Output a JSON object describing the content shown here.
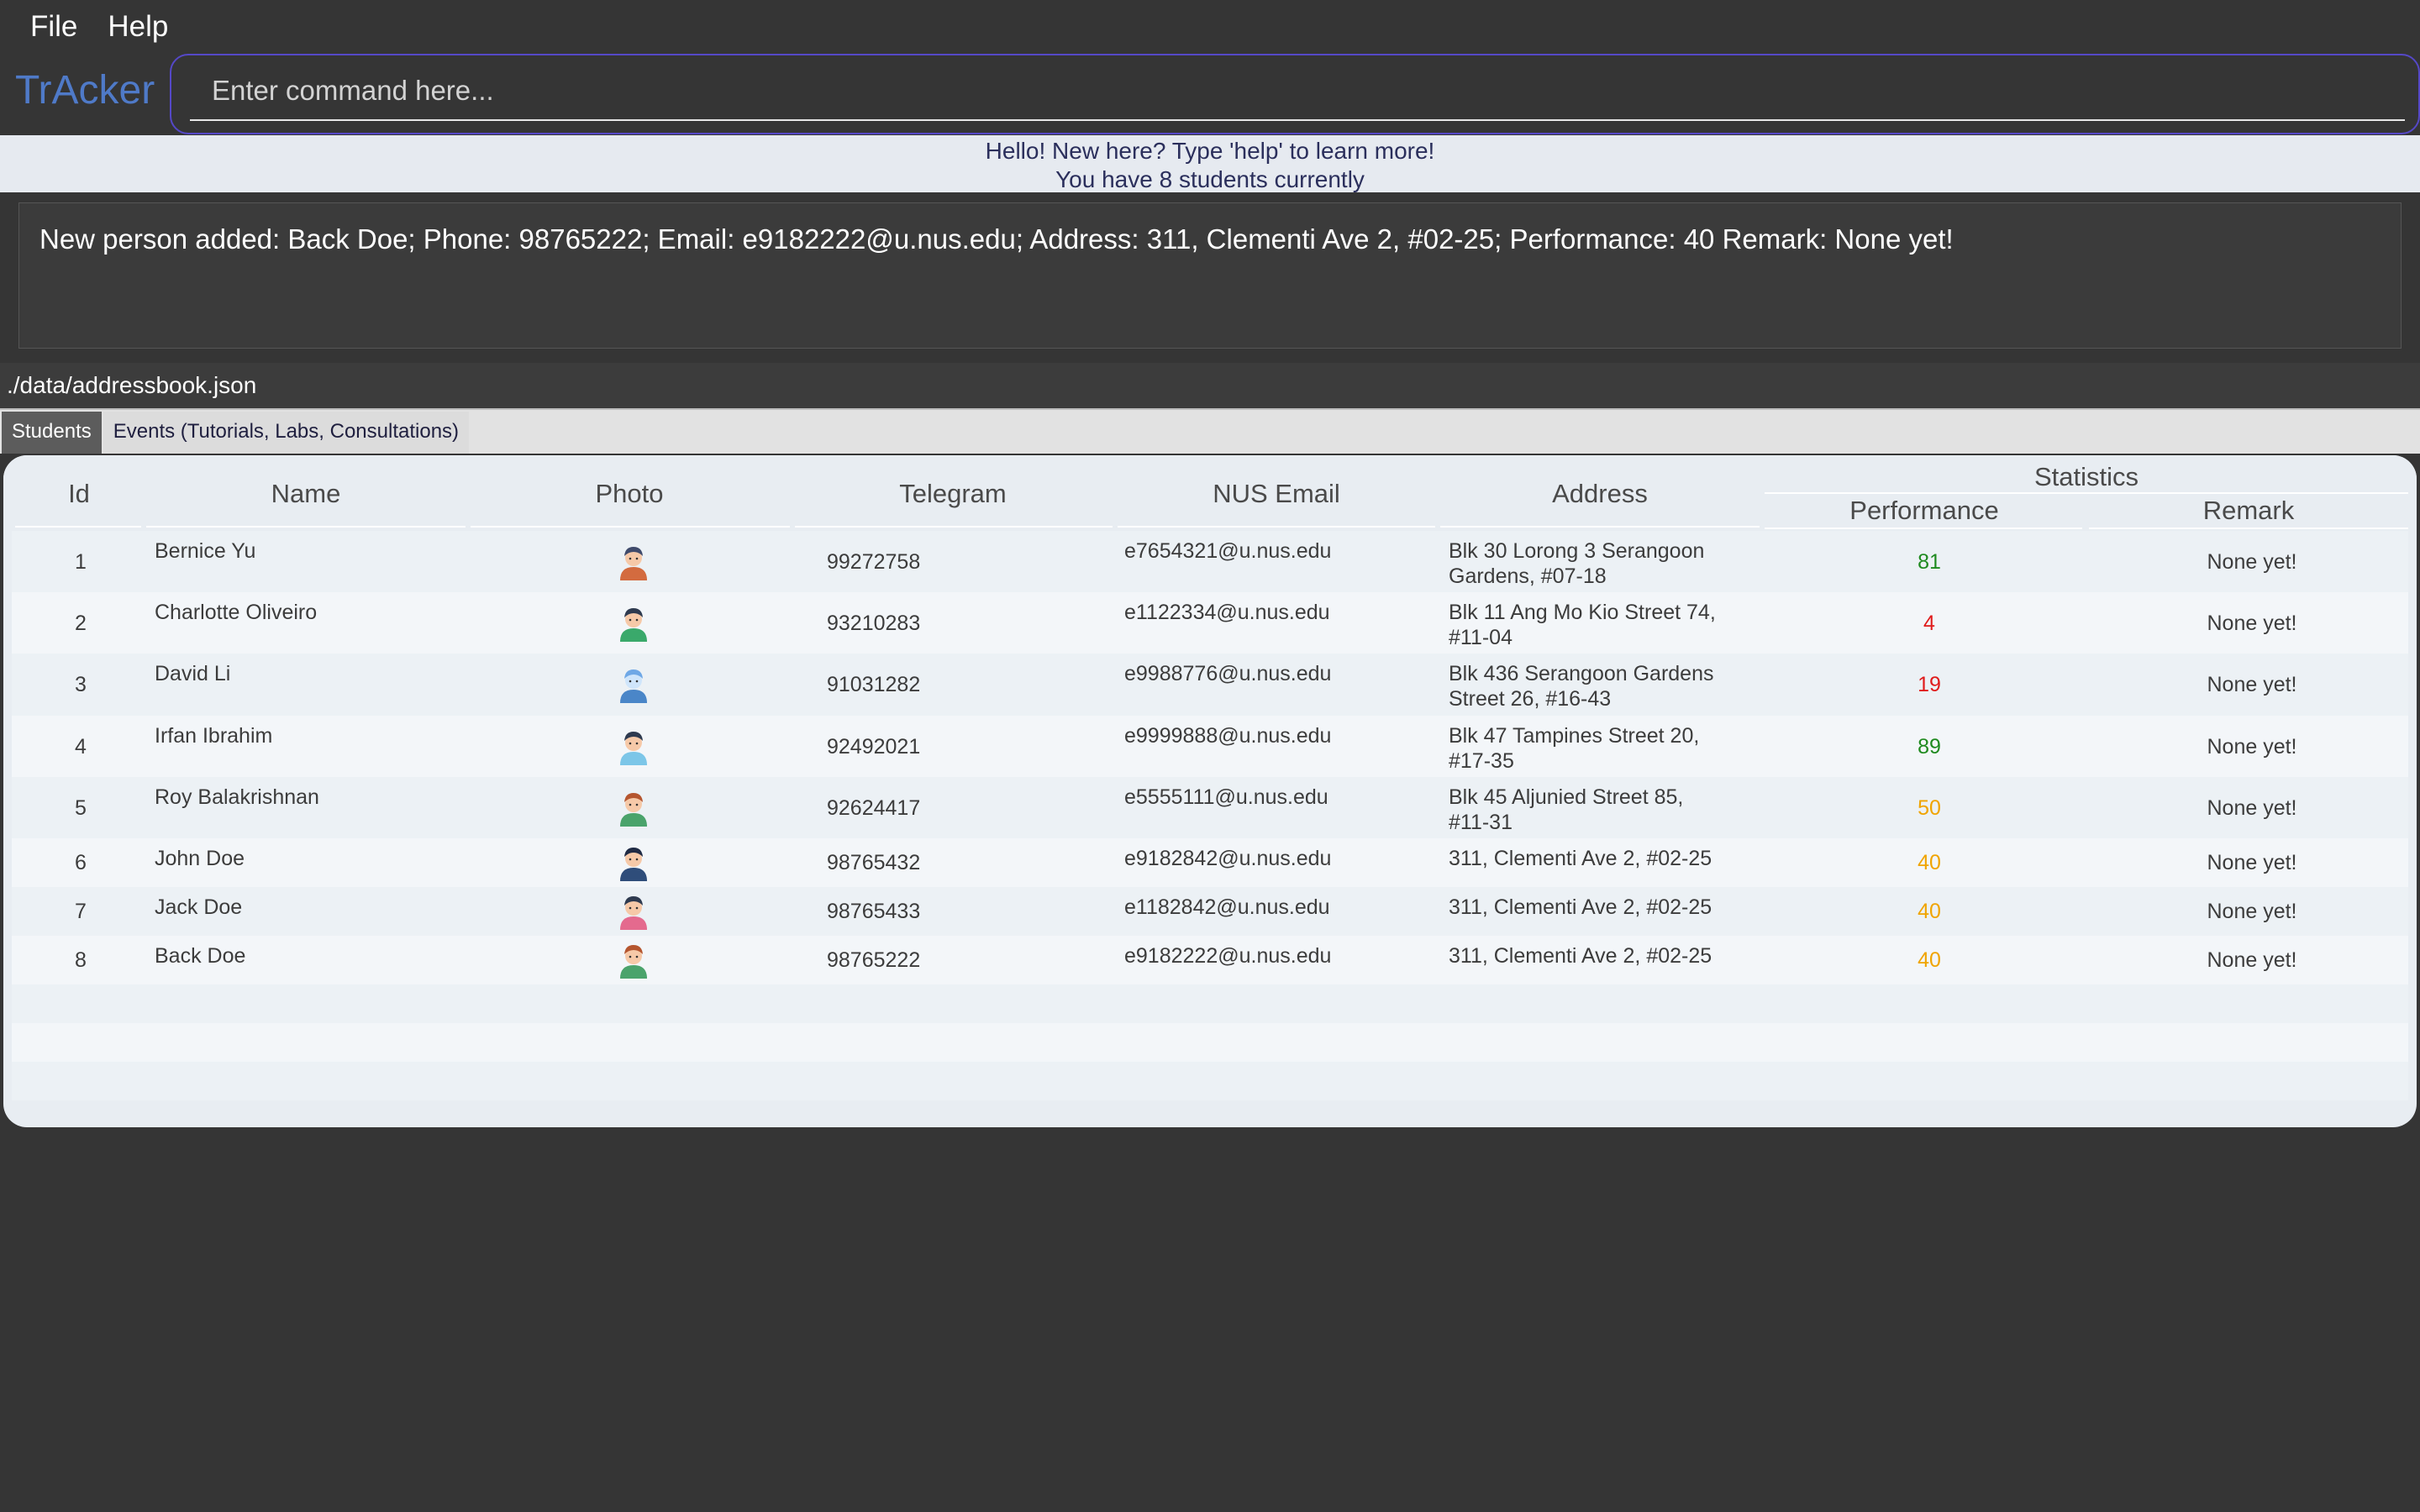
{
  "menu": {
    "file": "File",
    "help": "Help"
  },
  "app": {
    "title": "TrAcker"
  },
  "command": {
    "placeholder": "Enter command here...",
    "value": ""
  },
  "banner": {
    "line1": "Hello! New here? Type 'help' to learn more!",
    "line2": "You have 8 students currently"
  },
  "result": {
    "text": "New person added: Back Doe; Phone: 98765222; Email: e9182222@u.nus.edu; Address: 311, Clementi Ave 2, #02-25; Performance: 40 Remark: None yet!"
  },
  "path": "./data/addressbook.json",
  "tabs": [
    {
      "label": "Students",
      "active": true
    },
    {
      "label": "Events (Tutorials, Labs, Consultations)",
      "active": false
    }
  ],
  "table": {
    "headers": {
      "id": "Id",
      "name": "Name",
      "photo": "Photo",
      "telegram": "Telegram",
      "email": "NUS Email",
      "address": "Address",
      "statistics": "Statistics",
      "performance": "Performance",
      "remark": "Remark"
    },
    "colors": {
      "high": "#1f8a1f",
      "low": "#e01b1b",
      "mid": "#f0a400"
    },
    "rows": [
      {
        "id": "1",
        "name": "Bernice Yu",
        "avatar": "student-female-icon",
        "telegram": "99272758",
        "email": "e7654321@u.nus.edu",
        "address1": "Blk 30 Lorong 3 Serangoon",
        "address2": "Gardens, #07-18",
        "performance": "81",
        "level": "high",
        "remark": "None yet!"
      },
      {
        "id": "2",
        "name": "Charlotte Oliveiro",
        "avatar": "student-boy-icon",
        "telegram": "93210283",
        "email": "e1122334@u.nus.edu",
        "address1": "Blk 11 Ang Mo Kio Street 74,",
        "address2": "#11-04",
        "performance": "4",
        "level": "low",
        "remark": "None yet!"
      },
      {
        "id": "3",
        "name": "David Li",
        "avatar": "student-computer-icon",
        "telegram": "91031282",
        "email": "e9988776@u.nus.edu",
        "address1": "Blk 436 Serangoon Gardens",
        "address2": "Street 26, #16-43",
        "performance": "19",
        "level": "low",
        "remark": "None yet!"
      },
      {
        "id": "4",
        "name": "Irfan Ibrahim",
        "avatar": "student-tie-icon",
        "telegram": "92492021",
        "email": "e9999888@u.nus.edu",
        "address1": "Blk 47 Tampines Street 20,",
        "address2": "#17-35",
        "performance": "89",
        "level": "high",
        "remark": "None yet!"
      },
      {
        "id": "5",
        "name": "Roy Balakrishnan",
        "avatar": "student-girl-icon",
        "telegram": "92624417",
        "email": "e5555111@u.nus.edu",
        "address1": "Blk 45 Aljunied Street 85,",
        "address2": "#11-31",
        "performance": "50",
        "level": "mid",
        "remark": "None yet!"
      },
      {
        "id": "6",
        "name": "John Doe",
        "avatar": "graduate-icon",
        "telegram": "98765432",
        "email": "e9182842@u.nus.edu",
        "address1": "311, Clementi Ave 2, #02-25",
        "address2": "",
        "performance": "40",
        "level": "mid",
        "remark": "None yet!"
      },
      {
        "id": "7",
        "name": "Jack Doe",
        "avatar": "teacher-icon",
        "telegram": "98765433",
        "email": "e1182842@u.nus.edu",
        "address1": "311, Clementi Ave 2, #02-25",
        "address2": "",
        "performance": "40",
        "level": "mid",
        "remark": "None yet!"
      },
      {
        "id": "8",
        "name": "Back Doe",
        "avatar": "student-girl-icon",
        "telegram": "98765222",
        "email": "e9182222@u.nus.edu",
        "address1": "311, Clementi Ave 2, #02-25",
        "address2": "",
        "performance": "40",
        "level": "mid",
        "remark": "None yet!"
      }
    ]
  }
}
